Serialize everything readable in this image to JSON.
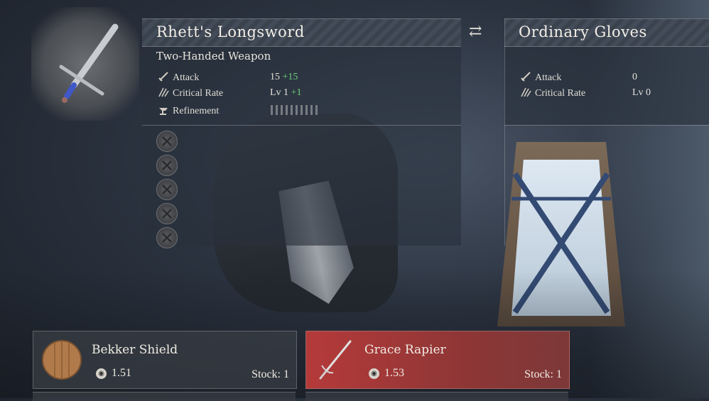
{
  "compare": {
    "swap_icon": "⇄",
    "left": {
      "name": "Rhett's Longsword",
      "type": "Two-Handed Weapon",
      "stats": [
        {
          "label": "Attack",
          "value": "15",
          "bonus": "+15",
          "icon": "sword-icon"
        },
        {
          "label": "Critical Rate",
          "value": "Lv 1",
          "bonus": "+1",
          "icon": "claw-icon"
        },
        {
          "label": "Refinement",
          "value": "",
          "bonus": "",
          "icon": "anvil-icon"
        }
      ],
      "refinement_level": 0,
      "augment_slots": 5
    },
    "right": {
      "name": "Ordinary Gloves",
      "stats": [
        {
          "label": "Attack",
          "value": "0",
          "icon": "sword-icon"
        },
        {
          "label": "Critical Rate",
          "value": "Lv 0",
          "icon": "claw-icon"
        }
      ]
    }
  },
  "shop": {
    "items": [
      {
        "name": "Bekker Shield",
        "price": "1.51",
        "stock": "Stock: 1",
        "icon": "shield-icon",
        "selected": false
      },
      {
        "name": "Grace Rapier",
        "price": "1.53",
        "stock": "Stock: 1",
        "icon": "rapier-icon",
        "selected": true
      }
    ]
  },
  "colors": {
    "bonus": "#6fd07a",
    "selected_card": "#b53a3a"
  }
}
